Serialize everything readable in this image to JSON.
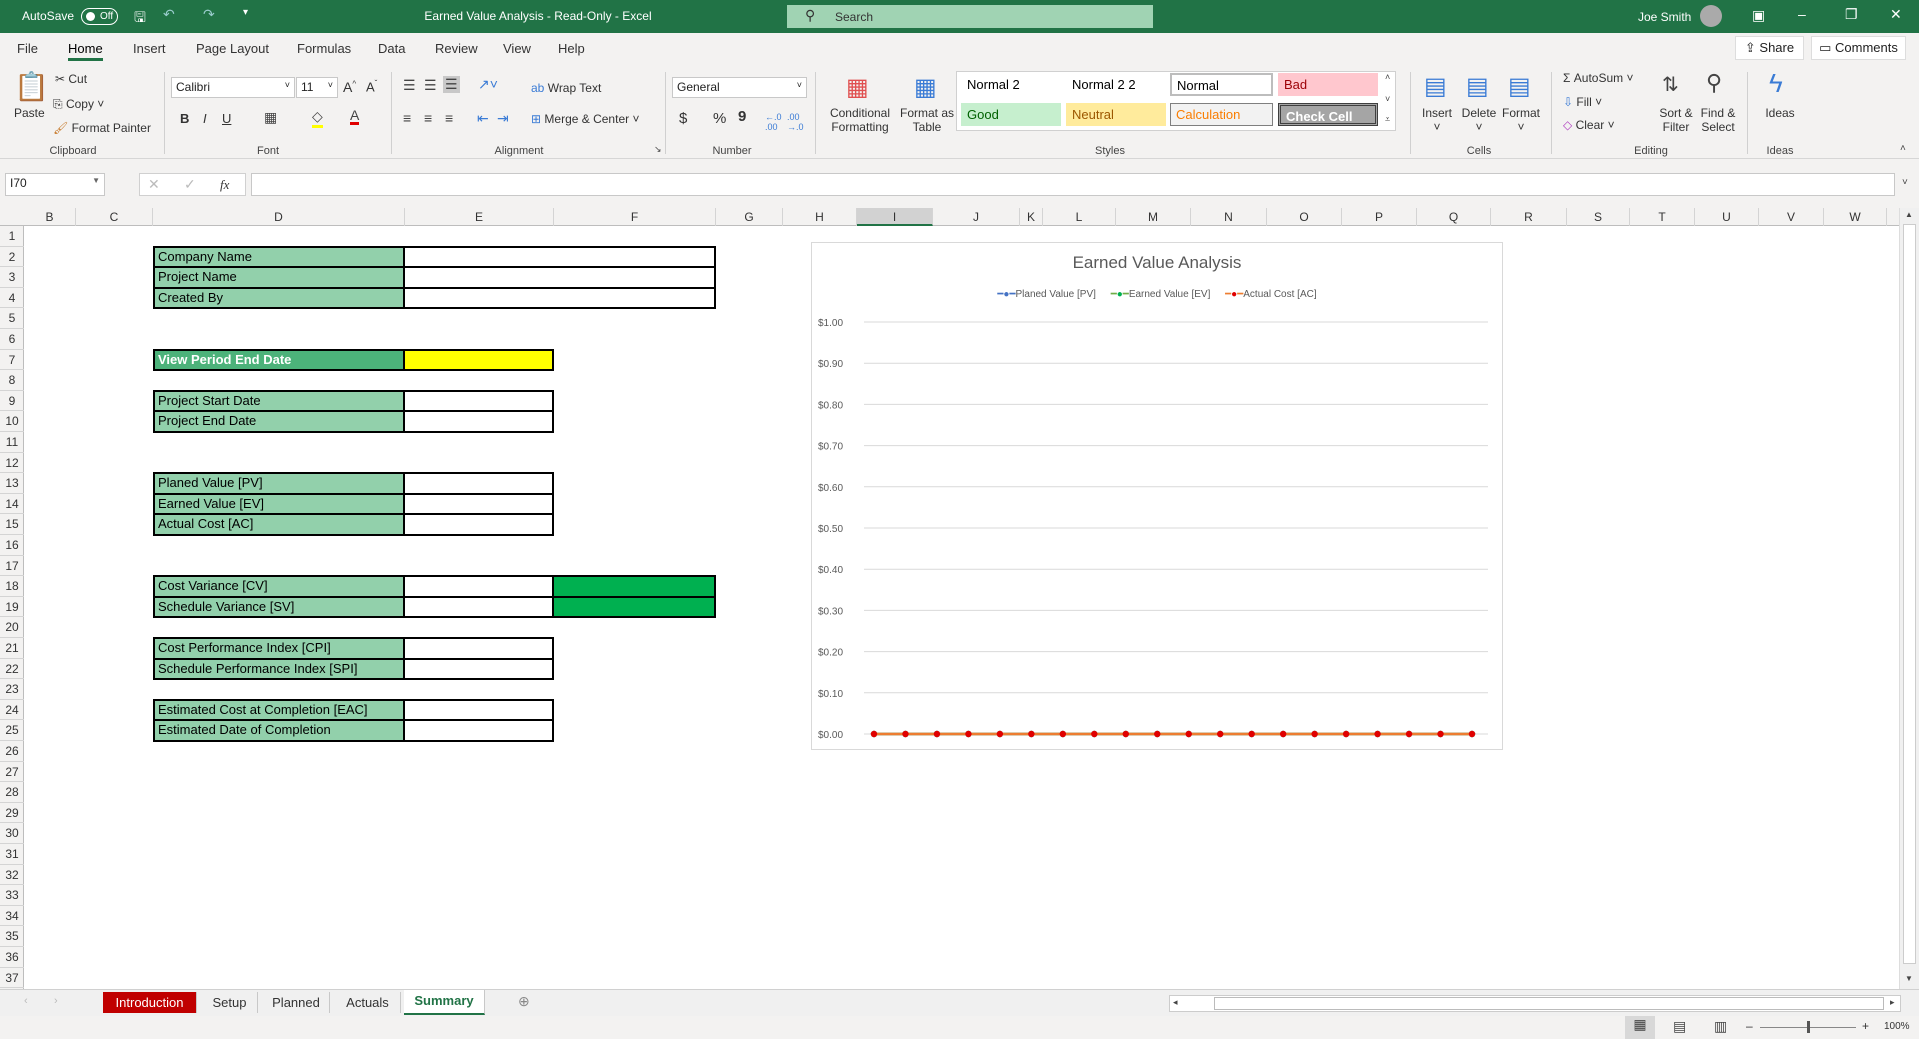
{
  "titlebar": {
    "autosave_label": "AutoSave",
    "autosave_state": "Off",
    "title": "Earned Value Analysis  -  Read-Only  -  Excel",
    "search_placeholder": "Search",
    "user": "Joe Smith"
  },
  "menu": {
    "tabs": [
      "File",
      "Home",
      "Insert",
      "Page Layout",
      "Formulas",
      "Data",
      "Review",
      "View",
      "Help"
    ],
    "active": "Home",
    "share": "Share",
    "comments": "Comments"
  },
  "ribbon": {
    "clipboard": {
      "paste": "Paste",
      "cut": "Cut",
      "copy": "Copy",
      "format_painter": "Format Painter",
      "label": "Clipboard"
    },
    "font": {
      "name": "Calibri",
      "size": "11",
      "label": "Font",
      "bold": "B",
      "italic": "I",
      "underline": "U"
    },
    "alignment": {
      "wrap_text": "Wrap Text",
      "merge_center": "Merge & Center",
      "label": "Alignment"
    },
    "number": {
      "format": "General",
      "label": "Number",
      "currency": "$",
      "percent": "%",
      "comma": "9"
    },
    "conditional_formatting": "Conditional Formatting",
    "format_as_table": "Format as Table",
    "styles": {
      "items": [
        "Normal 2",
        "Normal 2 2",
        "Normal",
        "Bad",
        "Good",
        "Neutral",
        "Calculation",
        "Check Cell"
      ],
      "label": "Styles"
    },
    "cells": {
      "insert": "Insert",
      "delete": "Delete",
      "format": "Format",
      "label": "Cells"
    },
    "editing": {
      "autosum": "AutoSum",
      "fill": "Fill",
      "clear": "Clear",
      "sort_filter": "Sort & Filter",
      "find_select": "Find & Select",
      "label": "Editing"
    },
    "ideas": {
      "button": "Ideas",
      "label": "Ideas"
    }
  },
  "formula_bar": {
    "name_box": "I70",
    "fx": "fx",
    "value": ""
  },
  "sheet": {
    "columns": [
      "B",
      "C",
      "D",
      "E",
      "F",
      "G",
      "H",
      "I",
      "J",
      "K",
      "L",
      "M",
      "N",
      "O",
      "P",
      "Q",
      "R",
      "S",
      "T",
      "U",
      "V",
      "W"
    ],
    "selected_column": "I",
    "labels": {
      "company_name": "Company Name",
      "project_name": "Project Name",
      "created_by": "Created By",
      "view_period_end_date": "View Period End Date",
      "project_start_date": "Project Start Date",
      "project_end_date": "Project End Date",
      "planed_value": "Planed Value [PV]",
      "earned_value": "Earned Value [EV]",
      "actual_cost": "Actual Cost [AC]",
      "cost_variance": "Cost Variance [CV]",
      "schedule_variance": "Schedule Variance [SV]",
      "cpi": "Cost Performance Index [CPI]",
      "spi": "Schedule Performance Index [SPI]",
      "eac": "Estimated Cost at Completion [EAC]",
      "edc": "Estimated Date of Completion"
    },
    "colors": {
      "label_fill": "#92d0ab",
      "header_fill": "#4cb27a",
      "highlight_yellow": "#ffff00",
      "variance_green": "#00b050"
    }
  },
  "chart_data": {
    "type": "line",
    "title": "Earned Value Analysis",
    "y_ticks": [
      "$0.00",
      "$0.10",
      "$0.20",
      "$0.30",
      "$0.40",
      "$0.50",
      "$0.60",
      "$0.70",
      "$0.80",
      "$0.90",
      "$1.00"
    ],
    "ylim": [
      0,
      1
    ],
    "grid": true,
    "legend": "top",
    "series": [
      {
        "name": "Planed Value [PV]",
        "color": "#4472c4",
        "values": [
          0,
          0,
          0,
          0,
          0,
          0,
          0,
          0,
          0,
          0,
          0,
          0,
          0,
          0,
          0,
          0,
          0,
          0,
          0,
          0
        ]
      },
      {
        "name": "Earned Value [EV]",
        "color": "#70ad47",
        "values": [
          0,
          0,
          0,
          0,
          0,
          0,
          0,
          0,
          0,
          0,
          0,
          0,
          0,
          0,
          0,
          0,
          0,
          0,
          0,
          0
        ]
      },
      {
        "name": "Actual Cost [AC]",
        "color": "#ed7d31",
        "marker": "#e00000",
        "values": [
          0,
          0,
          0,
          0,
          0,
          0,
          0,
          0,
          0,
          0,
          0,
          0,
          0,
          0,
          0,
          0,
          0,
          0,
          0,
          0
        ]
      }
    ]
  },
  "sheet_tabs": {
    "items": [
      "Introduction",
      "Setup",
      "Planned",
      "Actuals",
      "Summary"
    ],
    "active": "Summary",
    "intro_color": "#c00000"
  },
  "status": {
    "zoom": "100%"
  }
}
